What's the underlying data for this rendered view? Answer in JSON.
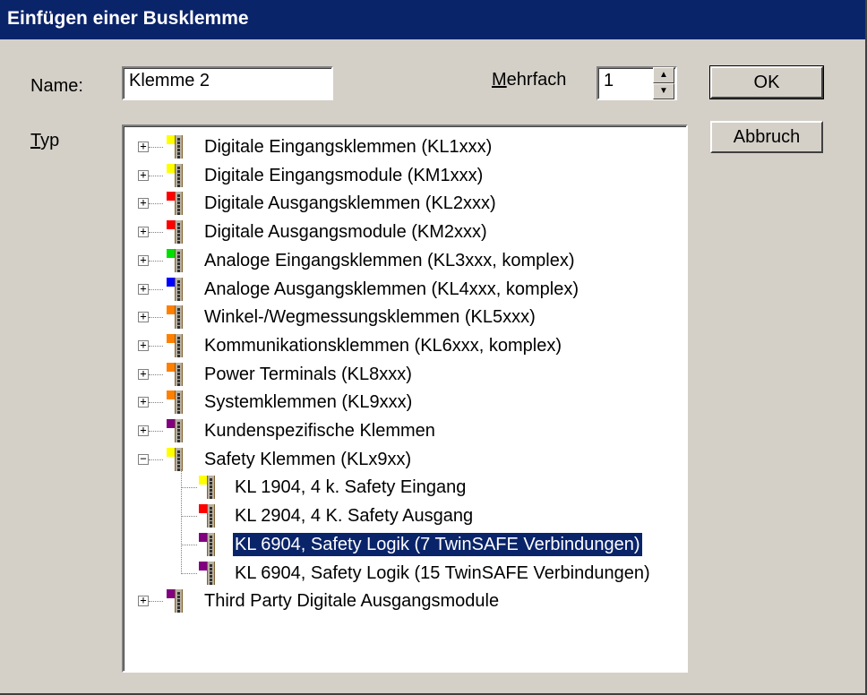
{
  "window": {
    "title": "Einfügen einer Busklemme"
  },
  "name": {
    "label_pre": "Name:",
    "value": "Klemme 2"
  },
  "mehrfach": {
    "label_u": "M",
    "label_rest": "ehrfach",
    "value": "1"
  },
  "typ": {
    "label_u": "T",
    "label_rest": "yp"
  },
  "buttons": {
    "ok": "OK",
    "cancel": "Abbruch"
  },
  "icons": {
    "expand": "plus-box",
    "collapse": "minus-box",
    "terminal": "bus-terminal-icon"
  },
  "colors": {
    "title_bar": "#0a246a",
    "selection": "#0a246a",
    "yellow": "#ffff00",
    "red": "#ff0000",
    "green": "#00e000",
    "blue": "#0000ff",
    "orange": "#ff8000",
    "purple": "#800080"
  },
  "tree": {
    "items": [
      {
        "label": "Digitale Eingangsklemmen (KL1xxx)",
        "color": "#ffff00",
        "state": "collapsed"
      },
      {
        "label": "Digitale Eingangsmodule (KM1xxx)",
        "color": "#ffff00",
        "state": "collapsed"
      },
      {
        "label": "Digitale Ausgangsklemmen (KL2xxx)",
        "color": "#ff0000",
        "state": "collapsed"
      },
      {
        "label": "Digitale Ausgangsmodule (KM2xxx)",
        "color": "#ff0000",
        "state": "collapsed"
      },
      {
        "label": "Analoge Eingangsklemmen (KL3xxx, komplex)",
        "color": "#00e000",
        "state": "collapsed"
      },
      {
        "label": "Analoge Ausgangsklemmen (KL4xxx, komplex)",
        "color": "#0000ff",
        "state": "collapsed"
      },
      {
        "label": "Winkel-/Wegmessungsklemmen (KL5xxx)",
        "color": "#ff8000",
        "state": "collapsed"
      },
      {
        "label": "Kommunikationsklemmen (KL6xxx, komplex)",
        "color": "#ff8000",
        "state": "collapsed"
      },
      {
        "label": "Power Terminals (KL8xxx)",
        "color": "#ff8000",
        "state": "collapsed"
      },
      {
        "label": "Systemklemmen (KL9xxx)",
        "color": "#ff8000",
        "state": "collapsed"
      },
      {
        "label": "Kundenspezifische Klemmen",
        "color": "#800080",
        "state": "collapsed"
      },
      {
        "label": "Safety Klemmen (KLx9xx)",
        "color": "#ffff00",
        "state": "expanded",
        "children": [
          {
            "label": "KL 1904, 4 k. Safety Eingang",
            "color": "#ffff00",
            "selected": false
          },
          {
            "label": "KL 2904, 4 K. Safety Ausgang",
            "color": "#ff0000",
            "selected": false
          },
          {
            "label": "KL 6904, Safety Logik (7 TwinSAFE Verbindungen)",
            "color": "#800080",
            "selected": true
          },
          {
            "label": "KL 6904, Safety Logik (15 TwinSAFE Verbindungen)",
            "color": "#800080",
            "selected": false
          }
        ]
      },
      {
        "label": "Third Party Digitale Ausgangsmodule",
        "color": "#800080",
        "state": "collapsed"
      }
    ]
  }
}
